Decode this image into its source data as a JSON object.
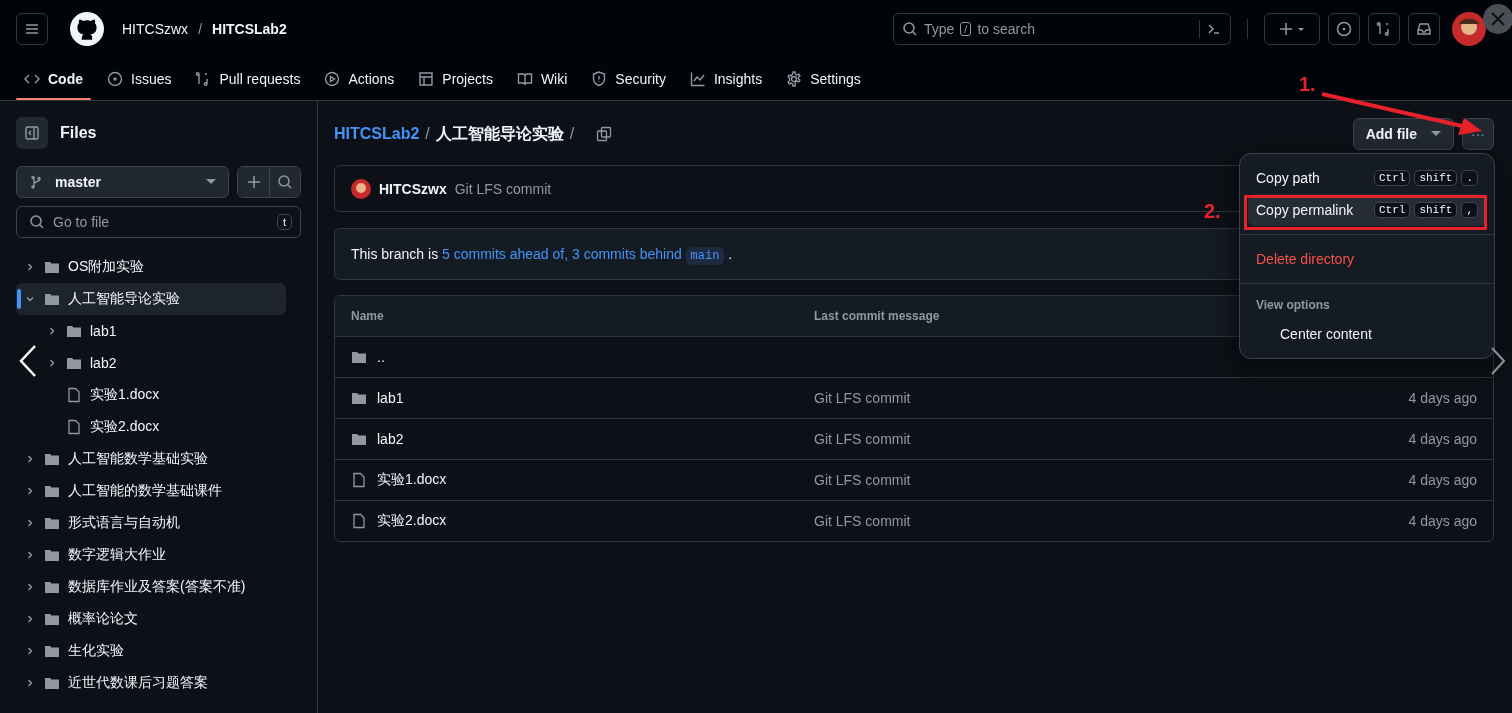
{
  "header": {
    "owner": "HITCSzwx",
    "separator": "/",
    "repo": "HITCSLab2",
    "search": {
      "placeholder_before": "Type",
      "placeholder_key": "/",
      "placeholder_after": "to search"
    }
  },
  "nav_tabs": [
    {
      "label": "Code",
      "kind": "code",
      "selected": true
    },
    {
      "label": "Issues",
      "kind": "issue",
      "selected": false
    },
    {
      "label": "Pull requests",
      "kind": "pr",
      "selected": false
    },
    {
      "label": "Actions",
      "kind": "play",
      "selected": false
    },
    {
      "label": "Projects",
      "kind": "table",
      "selected": false
    },
    {
      "label": "Wiki",
      "kind": "book",
      "selected": false
    },
    {
      "label": "Security",
      "kind": "shield",
      "selected": false
    },
    {
      "label": "Insights",
      "kind": "graph",
      "selected": false
    },
    {
      "label": "Settings",
      "kind": "gear",
      "selected": false
    }
  ],
  "sidebar": {
    "title": "Files",
    "branch": "master",
    "go_to_file": {
      "placeholder": "Go to file",
      "key": "t"
    },
    "tree": [
      {
        "name": "OS附加实验",
        "kind": "folder",
        "expanded": false,
        "selected": false
      },
      {
        "name": "人工智能导论实验",
        "kind": "folder",
        "expanded": true,
        "selected": true,
        "children": [
          {
            "name": "lab1",
            "kind": "folder",
            "expanded": false,
            "selected": false
          },
          {
            "name": "lab2",
            "kind": "folder",
            "expanded": false,
            "selected": false
          },
          {
            "name": "实验1.docx",
            "kind": "file",
            "selected": false
          },
          {
            "name": "实验2.docx",
            "kind": "file",
            "selected": false
          }
        ]
      },
      {
        "name": "人工智能数学基础实验",
        "kind": "folder",
        "expanded": false,
        "selected": false
      },
      {
        "name": "人工智能的数学基础课件",
        "kind": "folder",
        "expanded": false,
        "selected": false
      },
      {
        "name": "形式语言与自动机",
        "kind": "folder",
        "expanded": false,
        "selected": false
      },
      {
        "name": "数字逻辑大作业",
        "kind": "folder",
        "expanded": false,
        "selected": false
      },
      {
        "name": "数据库作业及答案(答案不准)",
        "kind": "folder",
        "expanded": false,
        "selected": false
      },
      {
        "name": "概率论论文",
        "kind": "folder",
        "expanded": false,
        "selected": false
      },
      {
        "name": "生化实验",
        "kind": "folder",
        "expanded": false,
        "selected": false
      },
      {
        "name": "近世代数课后习题答案",
        "kind": "folder",
        "expanded": false,
        "selected": false
      }
    ]
  },
  "breadcrumb": {
    "repo": "HITCSLab2",
    "separator": "/",
    "folder": "人工智能导论实验",
    "trailing": "/"
  },
  "add_file_button": "Add file",
  "more_button": "···",
  "latest_commit": {
    "author": "HITCSzwx",
    "message": "Git LFS commit"
  },
  "branch_info": {
    "prefix": "This branch is",
    "ahead_link": "5 commits ahead of,",
    "behind_link": "3 commits behind",
    "branch": "main",
    "suffix": "."
  },
  "table": {
    "columns": [
      "Name",
      "Last commit message"
    ],
    "rows": [
      {
        "kind": "parent",
        "name": ".."
      },
      {
        "kind": "folder",
        "name": "lab1",
        "message": "Git LFS commit",
        "date": "4 days ago"
      },
      {
        "kind": "folder",
        "name": "lab2",
        "message": "Git LFS commit",
        "date": "4 days ago"
      },
      {
        "kind": "file",
        "name": "实验1.docx",
        "message": "Git LFS commit",
        "date": "4 days ago"
      },
      {
        "kind": "file",
        "name": "实验2.docx",
        "message": "Git LFS commit",
        "date": "4 days ago"
      }
    ]
  },
  "menu": {
    "items": [
      {
        "kind": "action",
        "label": "Copy path",
        "keys": [
          "Ctrl",
          "shift",
          "."
        ],
        "selected": false
      },
      {
        "kind": "action",
        "label": "Copy permalink",
        "keys": [
          "Ctrl",
          "shift",
          ","
        ],
        "selected": true
      },
      {
        "kind": "divider"
      },
      {
        "kind": "danger",
        "label": "Delete directory"
      },
      {
        "kind": "divider"
      },
      {
        "kind": "heading",
        "label": "View options"
      },
      {
        "kind": "option",
        "label": "Center content"
      }
    ]
  },
  "annotations": [
    {
      "label": "1."
    },
    {
      "label": "2."
    }
  ]
}
